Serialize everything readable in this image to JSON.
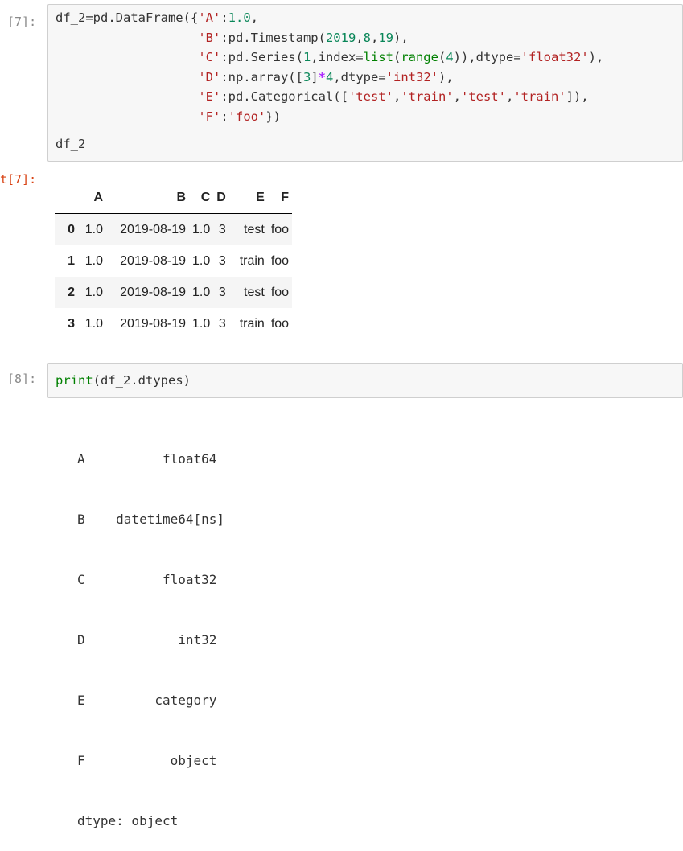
{
  "cells": [
    {
      "in_prompt": "[7]:",
      "out_prompt": "t[7]:",
      "code_last_line": "df_2",
      "dataframe": {
        "columns": [
          "",
          "A",
          "B",
          "C",
          "D",
          "E",
          "F"
        ],
        "rows": [
          [
            "0",
            "1.0",
            "2019-08-19",
            "1.0",
            "3",
            "test",
            "foo"
          ],
          [
            "1",
            "1.0",
            "2019-08-19",
            "1.0",
            "3",
            "train",
            "foo"
          ],
          [
            "2",
            "1.0",
            "2019-08-19",
            "1.0",
            "3",
            "test",
            "foo"
          ],
          [
            "3",
            "1.0",
            "2019-08-19",
            "1.0",
            "3",
            "train",
            "foo"
          ]
        ]
      }
    },
    {
      "in_prompt": "[8]:",
      "output_lines": [
        "A          float64",
        "B    datetime64[ns]",
        "C          float32",
        "D            int32",
        "E         category",
        "F           object",
        "dtype: object"
      ]
    }
  ]
}
